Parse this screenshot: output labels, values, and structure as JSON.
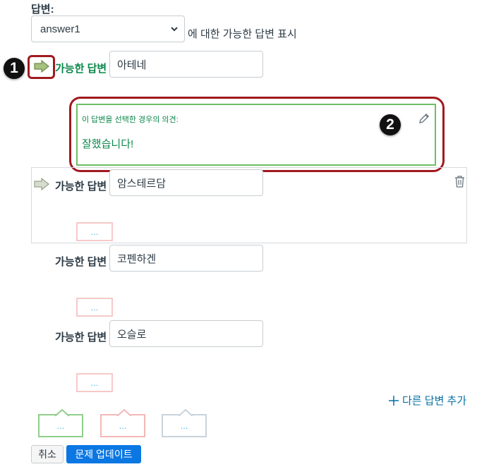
{
  "header": {
    "label": "답변:"
  },
  "select": {
    "value": "answer1",
    "suffix": "에 대한 가능한 답변 표시"
  },
  "badges": {
    "first": "1",
    "second": "2"
  },
  "answers": [
    {
      "label": "가능한 답변",
      "value": "아테네",
      "correct": true
    },
    {
      "label": "가능한 답변",
      "value": "암스테르담",
      "correct": false
    },
    {
      "label": "가능한 답변",
      "value": "코펜하겐",
      "correct": false
    },
    {
      "label": "가능한 답변",
      "value": "오슬로",
      "correct": false
    }
  ],
  "comment": {
    "title": "이 답변을 선택한 경우의 의견:",
    "text": "잘했습니다!"
  },
  "dots": "...",
  "add_answer": "다른 답변 추가",
  "callouts": [
    "...",
    "...",
    "..."
  ],
  "buttons": {
    "cancel": "취소",
    "update": "문제 업데이트"
  },
  "colors": {
    "correct": "#0b874b",
    "highlight": "#a01a1f",
    "primary": "#0b77e3",
    "callout_green": "#8fcf8a",
    "callout_red": "#f4b8b8",
    "callout_gray": "#c8d3dc"
  }
}
